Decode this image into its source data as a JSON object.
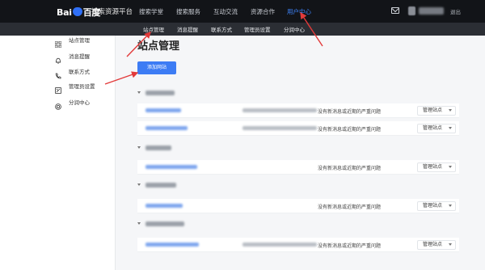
{
  "header": {
    "logo_text_a": "Bai",
    "logo_text_b": "百度",
    "platform_name": "搜索资源平台",
    "nav": [
      "搜索学堂",
      "搜索服务",
      "互动交流",
      "资源合作",
      "用户中心"
    ],
    "active_nav": "用户中心",
    "logout": "退出"
  },
  "subnav": [
    "站点管理",
    "消息提醒",
    "联系方式",
    "管理员设置",
    "分润中心"
  ],
  "sidebar": {
    "items": [
      {
        "label": "站点管理",
        "icon": "grid-icon"
      },
      {
        "label": "消息提醒",
        "icon": "bell-icon"
      },
      {
        "label": "联系方式",
        "icon": "phone-icon"
      },
      {
        "label": "管理员设置",
        "icon": "admin-icon"
      },
      {
        "label": "分润中心",
        "icon": "target-icon"
      }
    ]
  },
  "main": {
    "title": "站点管理",
    "add_button": "添加网站",
    "row_note": "没有新消息或近期的严重问题",
    "manage_label": "管理站点"
  },
  "colors": {
    "topbar": "#121418",
    "subbar": "#2b2e34",
    "accent": "#3d7cf4",
    "arrow": "#e23a3a"
  }
}
